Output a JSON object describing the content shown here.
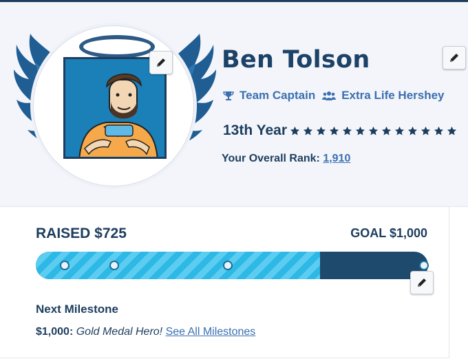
{
  "profile": {
    "name": "Ben Tolson",
    "role": "Team Captain",
    "team": "Extra Life Hershey",
    "year_label": "13th Year",
    "star_count": 13,
    "rank_label": "Your Overall Rank:",
    "rank_value": "1,910"
  },
  "progress": {
    "raised_label": "RAISED $725",
    "goal_label": "GOAL $1,000",
    "percent": 72.5,
    "milestone_dots_percent": [
      7.4,
      20,
      49,
      99
    ],
    "next_milestone_title": "Next Milestone",
    "next_milestone_amount": "$1,000:",
    "next_milestone_name": "Gold Medal Hero!",
    "see_all_label": "See All Milestones"
  },
  "icons": {
    "role": "trophy-icon",
    "team": "users-icon",
    "edit": "pencil-icon",
    "year": "star-icon"
  },
  "colors": {
    "navy": "#1d3d5e",
    "link": "#3a6fb0",
    "bar_fill": "#2db8e6",
    "bar_track": "#1e4a6e",
    "wings": "#1f5d93"
  }
}
